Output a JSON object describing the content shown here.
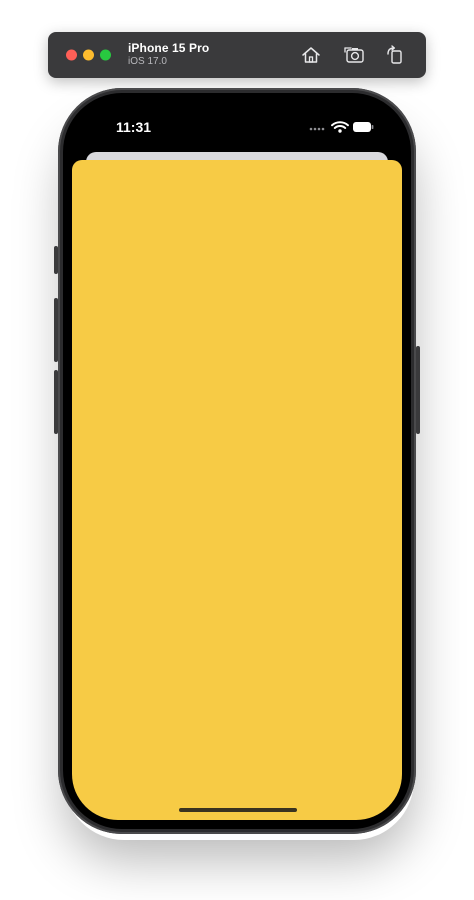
{
  "simulator": {
    "device_name": "iPhone 15 Pro",
    "os_version": "iOS 17.0",
    "buttons": {
      "home": "home-icon",
      "screenshot": "camera-icon",
      "rotate": "rotate-icon"
    }
  },
  "status_bar": {
    "time": "11:31",
    "icons": [
      "cellular-dots-icon",
      "wifi-icon",
      "battery-icon"
    ]
  },
  "screen": {
    "background_color": "#f7cb45",
    "behind_sheet_color": "#d9d9dc"
  },
  "colors": {
    "toolbar": "#3a3a3c",
    "close": "#ff5f57",
    "minimize": "#febc2e",
    "maximize": "#28c840"
  }
}
